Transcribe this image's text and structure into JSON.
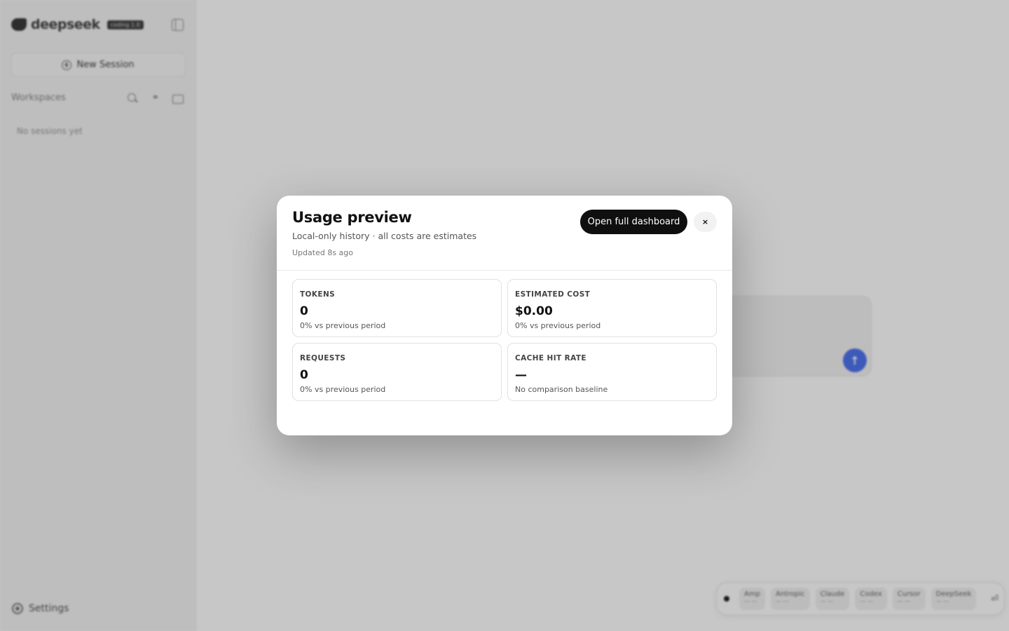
{
  "sidebar": {
    "logo_text": "deepseek",
    "logo_badge": "coding 1.0",
    "new_session_label": "New Session",
    "workspaces_label": "Workspaces",
    "empty_text": "No sessions yet",
    "settings_label": "Settings"
  },
  "agent_bar": {
    "agents": [
      {
        "name": "Amp",
        "sub": "— —"
      },
      {
        "name": "Antropic",
        "sub": "— —"
      },
      {
        "name": "Claude",
        "sub": "— —"
      },
      {
        "name": "Codex",
        "sub": "— —"
      },
      {
        "name": "Cursor",
        "sub": "— —"
      },
      {
        "name": "DeepSeek",
        "sub": "— —"
      }
    ],
    "arrow_icon": "⏎"
  },
  "modal": {
    "title": "Usage preview",
    "subtitle": "Local-only history · all costs are estimates",
    "updated": "Updated 8s ago",
    "dashboard_button": "Open full dashboard",
    "close_label": "×",
    "cards": [
      {
        "label": "TOKENS",
        "value": "0",
        "delta": "0% vs previous period"
      },
      {
        "label": "ESTIMATED COST",
        "value": "$0.00",
        "delta": "0% vs previous period"
      },
      {
        "label": "REQUESTS",
        "value": "0",
        "delta": "0% vs previous period"
      },
      {
        "label": "CACHE HIT RATE",
        "value": "—",
        "delta": "No comparison baseline"
      }
    ]
  },
  "colors": {
    "accent": "#4f74f0",
    "primary_button": "#0f0f0f"
  }
}
